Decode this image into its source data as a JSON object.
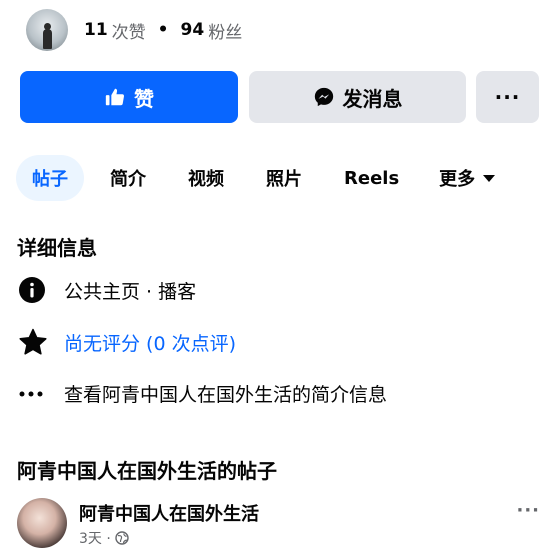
{
  "stats": {
    "likes_count": "11",
    "likes_label": "次赞",
    "separator": "•",
    "followers_count": "94",
    "followers_label": "粉丝"
  },
  "actions": {
    "like_label": "赞",
    "message_label": "发消息",
    "more_label": "···"
  },
  "tabs": [
    {
      "label": "帖子",
      "active": true
    },
    {
      "label": "简介",
      "active": false
    },
    {
      "label": "视频",
      "active": false
    },
    {
      "label": "照片",
      "active": false
    },
    {
      "label": "Reels",
      "active": false
    },
    {
      "label": "更多",
      "active": false
    }
  ],
  "details": {
    "title": "详细信息",
    "category": "公共主页 · 播客",
    "rating": "尚无评分 (0 次点评)",
    "about_link": "查看阿青中国人在国外生活的简介信息"
  },
  "posts_section": {
    "title": "阿青中国人在国外生活的帖子"
  },
  "post": {
    "author": "阿青中国人在国外生活",
    "time": "3天 ·",
    "more_label": "···"
  },
  "colors": {
    "accent": "#0866ff",
    "button_gray": "#e4e6eb",
    "tab_active_bg": "#ebf5ff",
    "icon_gray": "#65676b"
  }
}
